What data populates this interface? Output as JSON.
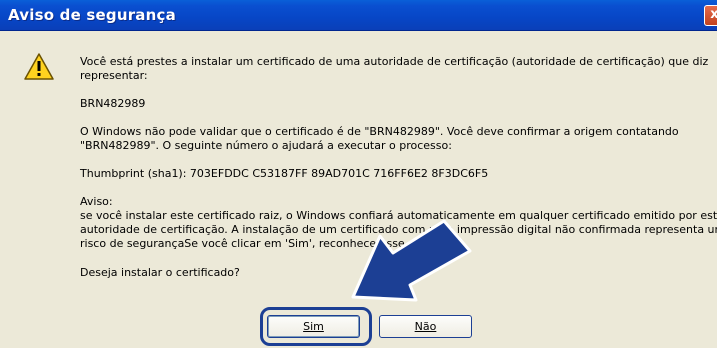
{
  "window": {
    "title": "Aviso de segurança",
    "close_glyph": "x"
  },
  "icons": {
    "warning": "warning-icon",
    "close": "close-icon",
    "arrow": "arrow-icon"
  },
  "message": {
    "line1": "Você está prestes a instalar um certificado de uma autoridade de certificação (autoridade de certificação) que diz",
    "line2": "representar:",
    "issuer": "BRN482989",
    "validate_line1": "O Windows não pode validar que o certificado é de \"BRN482989\". Você deve confirmar a origem contatando",
    "validate_line2": "\"BRN482989\". O seguinte número o ajudará a executar o processo:",
    "thumbprint": "Thumbprint (sha1): 703EFDDC C53187FF 89AD701C 716FF6E2 8F3DC6F5",
    "aviso_heading": "Aviso:",
    "aviso_line1": "se você instalar este certificado raiz, o Windows confiará automaticamente em qualquer certificado emitido por esta",
    "aviso_line2": "autoridade de certificação. A instalação de um certificado com uma impressão digital não confirmada representa um",
    "aviso_line3": "risco de segurançaSe você clicar em 'Sim', reconhece esse risco.",
    "question": "Deseja instalar o certificado?"
  },
  "buttons": {
    "yes_label": "Sim",
    "no_label": "Não"
  },
  "colors": {
    "titlebar": "#0746c6",
    "dialog_bg": "#ece9d8",
    "highlight": "#1c3f94"
  }
}
